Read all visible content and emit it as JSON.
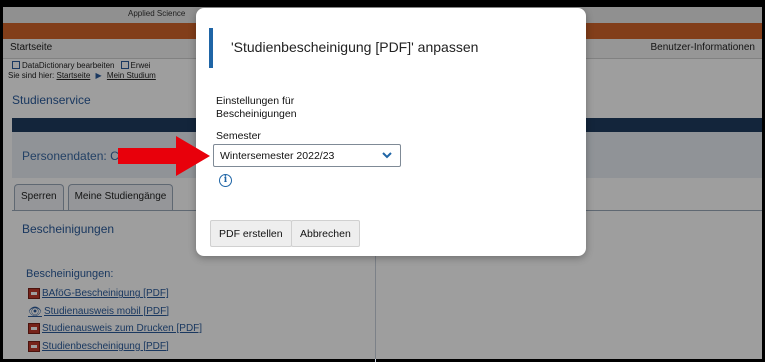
{
  "background": {
    "brand_line": "Applied Science",
    "nav": {
      "home": "Startseite",
      "user_info": "Benutzer-Informationen"
    },
    "toolbar": {
      "datadictionary": "DataDictionary bearbeiten",
      "extended": "Erwei"
    },
    "breadcrumb": {
      "prefix": "Sie sind hier:",
      "items": [
        "Startseite",
        "Mein Studium"
      ]
    },
    "section_title": "Studienservice",
    "person_label": "Personendaten: C",
    "tabs": [
      "Sperren",
      "Meine Studiengänge"
    ],
    "content_title": "Bescheinigungen",
    "list_heading": "Bescheinigungen:",
    "list_items": [
      {
        "label": "BAföG-Bescheinigung [PDF]",
        "icon": "pdf-icon"
      },
      {
        "label": "Studienausweis mobil [PDF]",
        "icon": "eye-icon"
      },
      {
        "label": "Studienausweis zum Drucken [PDF]",
        "icon": "pdf-icon"
      },
      {
        "label": "Studienbescheinigung [PDF]",
        "icon": "pdf-icon"
      }
    ]
  },
  "modal": {
    "title": "'Studienbescheinigung [PDF]' anpassen",
    "subtitle": "Einstellungen für Bescheinigungen",
    "semester_label": "Semester",
    "semester_value": "Wintersemester 2022/23",
    "buttons": {
      "create_pdf": "PDF erstellen",
      "cancel": "Abbrechen"
    }
  },
  "colors": {
    "accent_blue": "#1f65a6",
    "link_blue": "#2a5b9b",
    "orange_band": "#d2642a",
    "dark_band": "#1f3d5f",
    "annotation_arrow": "#e8000b"
  }
}
